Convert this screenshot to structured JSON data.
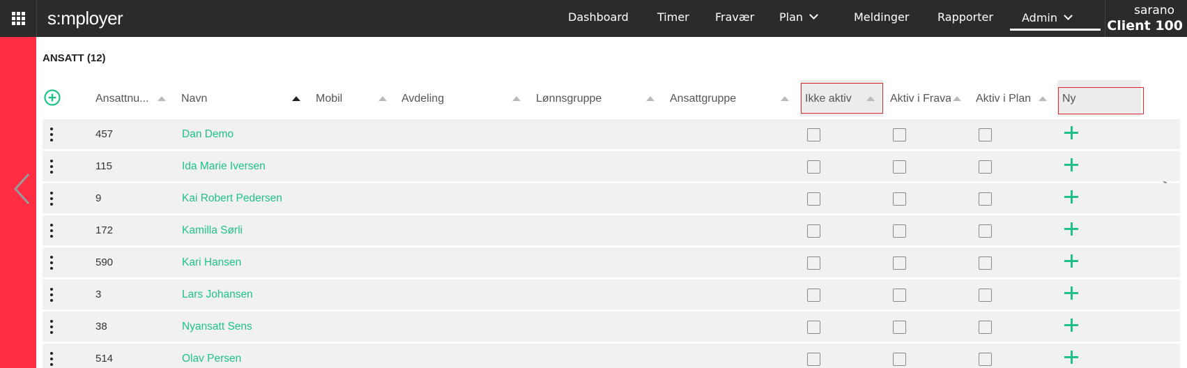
{
  "app": {
    "logo": "s:mployer",
    "nav": {
      "dashboard": "Dashboard",
      "timer": "Timer",
      "fravaer": "Fravær",
      "plan": "Plan",
      "meldinger": "Meldinger",
      "rapporter": "Rapporter",
      "admin": "Admin"
    },
    "user": {
      "name": "sarano",
      "client": "Client 100"
    }
  },
  "section": {
    "title": "ANSATT (12)"
  },
  "table": {
    "columns": {
      "ansattnummer": "Ansattnu...",
      "navn": "Navn",
      "mobil": "Mobil",
      "avdeling": "Avdeling",
      "lonnsgruppe": "Lønnsgruppe",
      "ansattgruppe": "Ansattgruppe",
      "ikke_aktiv": "Ikke aktiv",
      "aktiv_fravaer": "Aktiv i Frava",
      "aktiv_plan": "Aktiv i Plan",
      "ny": "Ny"
    },
    "sorted_column": "Navn",
    "rows": [
      {
        "num": "457",
        "name": "Dan Demo"
      },
      {
        "num": "115",
        "name": "Ida Marie Iversen"
      },
      {
        "num": "9",
        "name": "Kai Robert Pedersen"
      },
      {
        "num": "172",
        "name": "Kamilla Sørli"
      },
      {
        "num": "590",
        "name": "Kari Hansen"
      },
      {
        "num": "3",
        "name": "Lars Johansen"
      },
      {
        "num": "38",
        "name": "Nyansatt Sens"
      },
      {
        "num": "514",
        "name": "Olav Persen"
      }
    ]
  },
  "colors": {
    "topbar": "#2b2b2b",
    "accent_red": "#ff2e45",
    "accent_green": "#1fc08c",
    "highlight_border": "#e0242d"
  },
  "icons": {
    "apps": "grid-icon",
    "add": "add-circle-icon",
    "prev": "chevron-left-icon",
    "next": "chevron-right-icon",
    "row_menu": "vertical-dots-icon",
    "new": "plus-icon"
  }
}
